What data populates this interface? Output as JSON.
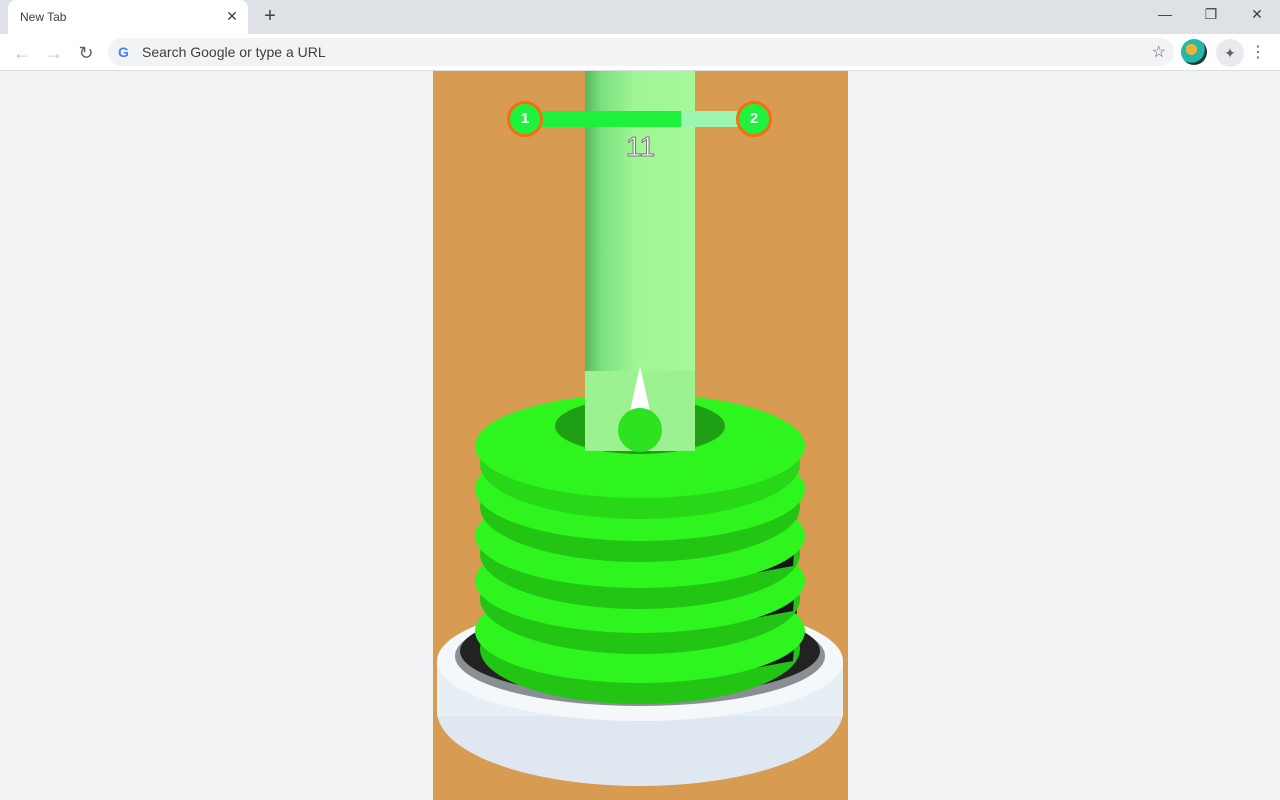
{
  "browser": {
    "tab_title": "New Tab",
    "tab_close": "✕",
    "new_tab": "+",
    "window": {
      "minimize": "—",
      "restore": "❐",
      "close": "✕"
    },
    "nav": {
      "back": "←",
      "forward": "→",
      "reload": "↻"
    },
    "omnibox": {
      "icon": "G",
      "placeholder": "Search Google or type a URL"
    },
    "bookmark_star": "☆",
    "extensions_icon": "✦",
    "menu_icon": "⋮"
  },
  "game": {
    "current_level": "1",
    "next_level": "2",
    "level_progress_percent": 70,
    "score": "11",
    "colors": {
      "background": "#d89b52",
      "stack": "#2ff51f",
      "hazard": "#15161a",
      "pole": "#a0f594",
      "badge_border": "#f26f12"
    }
  }
}
